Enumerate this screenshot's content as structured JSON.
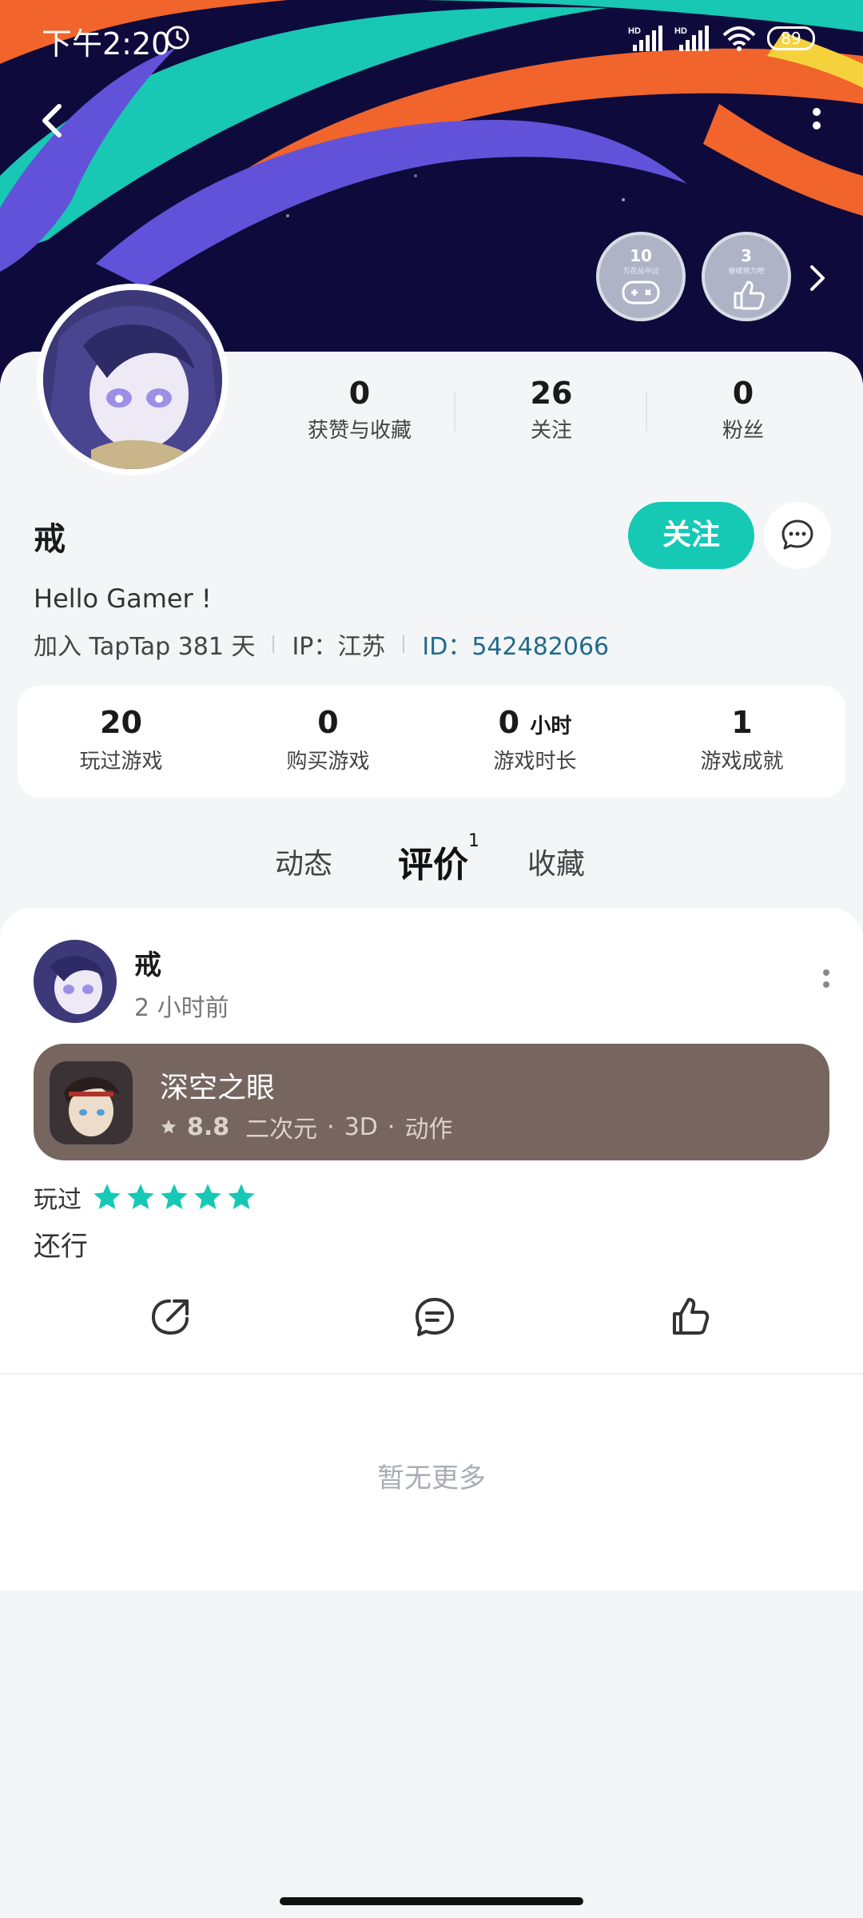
{
  "status_bar": {
    "time": "下午2:20",
    "battery": "89"
  },
  "badges": [
    {
      "num": "10",
      "sub": "万花丛中过"
    },
    {
      "num": "3",
      "sub": "继续努力吧"
    }
  ],
  "profile": {
    "name": "戒",
    "bio": "Hello Gamer !",
    "joined": "加入 TapTap 381 天",
    "ip": "IP：江苏",
    "id": "ID：542482066",
    "follow_label": "关注"
  },
  "top_stats": [
    {
      "value": "0",
      "label": "获赞与收藏"
    },
    {
      "value": "26",
      "label": "关注"
    },
    {
      "value": "0",
      "label": "粉丝"
    }
  ],
  "game_stats": [
    {
      "value": "20",
      "unit": "",
      "label": "玩过游戏"
    },
    {
      "value": "0",
      "unit": "",
      "label": "购买游戏"
    },
    {
      "value": "0",
      "unit": "小时",
      "label": "游戏时长"
    },
    {
      "value": "1",
      "unit": "",
      "label": "游戏成就"
    }
  ],
  "tabs": {
    "dynamic": "动态",
    "review": "评价",
    "review_count": "1",
    "collect": "收藏"
  },
  "review": {
    "author": "戒",
    "time": "2 小时前",
    "game": {
      "name": "深空之眼",
      "rating": "8.8",
      "tags": [
        "二次元",
        "3D",
        "动作"
      ]
    },
    "played_label": "玩过",
    "stars": 5,
    "text": "还行"
  },
  "footer": {
    "no_more": "暂无更多"
  },
  "colors": {
    "accent": "#15C9B5",
    "game_chip": "#776660",
    "id_link": "#1E6B8C"
  }
}
